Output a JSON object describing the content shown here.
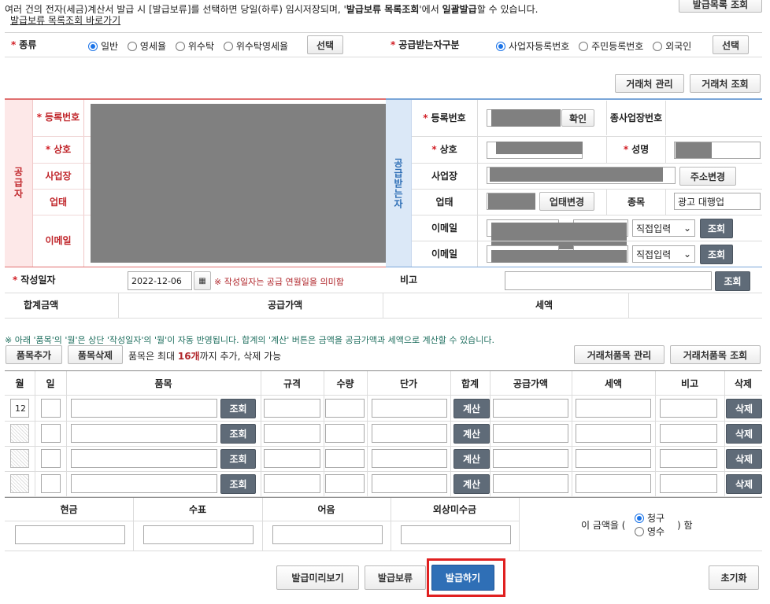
{
  "notice": {
    "line1_pre": "여러 건의 전자(세금)계산서 발급 시 [발급보류]를 선택하면 당일(하루) 임시저장되며, '",
    "line1_b1": "발급보류 목록조회",
    "line1_mid": "'에서 ",
    "line1_b2": "일괄발급",
    "line1_post": "할 수 있습니다.",
    "link": "발급보류 목록조회 바로가기",
    "top_button": "발급목록 조회"
  },
  "type_row": {
    "label": "종류",
    "options": [
      "일반",
      "영세율",
      "위수탁",
      "위수탁영세율"
    ],
    "selected": "일반",
    "select_button": "선택",
    "recipient_label": "공급받는자구분",
    "recipient_options": [
      "사업자등록번호",
      "주민등록번호",
      "외국인"
    ],
    "recipient_selected": "사업자등록번호",
    "recipient_button": "선택"
  },
  "partner_buttons": {
    "manage": "거래처 관리",
    "lookup": "거래처 조회"
  },
  "supplier": {
    "side_label": "공급자",
    "reg_no": "등록번호",
    "company": "상호",
    "address": "사업장",
    "business_type": "업태",
    "email": "이메일"
  },
  "receiver": {
    "side_label": "공급받는자",
    "reg_no": "등록번호",
    "confirm_button": "확인",
    "sub_business": "종사업장번호",
    "company": "상호",
    "name": "성명",
    "address": "사업장",
    "address_button": "주소변경",
    "business_type": "업태",
    "business_button": "업태변경",
    "item_label": "종목",
    "item_value": "광고 대행업",
    "email": "이메일",
    "email_select": "직접입력",
    "lookup_button": "조회"
  },
  "date_row": {
    "label": "작성일자",
    "value": "2022-12-06",
    "note": "※ 작성일자는 공급 연월일을 의미함",
    "memo_label": "비고",
    "lookup_button": "조회"
  },
  "totals": {
    "total": "합계금액",
    "supply": "공급가액",
    "tax": "세액"
  },
  "items_notice": "※ 아래 '품목'의 '월'은 상단 '작성일자'의 '월'이 자동 반영됩니다. 합계의 '계산' 버튼은 금액을 공급가액과 세액으로 계산할 수 있습니다.",
  "item_toolbar": {
    "add": "품목추가",
    "delete": "품목삭제",
    "limit_pre": "품목은 최대 ",
    "limit_num": "16개",
    "limit_post": "까지 추가, 삭제 가능",
    "manage": "거래처품목 관리",
    "lookup": "거래처품목 조회"
  },
  "item_table": {
    "headers": [
      "월",
      "일",
      "품목",
      "규격",
      "수량",
      "단가",
      "합계",
      "공급가액",
      "세액",
      "비고",
      "삭제"
    ],
    "first_month": "12",
    "lookup": "조회",
    "calc": "계산",
    "delete": "삭제"
  },
  "payment": {
    "headers": [
      "현금",
      "수표",
      "어음",
      "외상미수금"
    ],
    "amount_pre": "이 금액을 (",
    "amount_post": ") 함",
    "options": [
      "청구",
      "영수"
    ],
    "selected": "청구"
  },
  "actions": {
    "preview": "발급미리보기",
    "hold": "발급보류",
    "issue": "발급하기",
    "reset": "초기화"
  },
  "colors": {
    "primary": "#2f6fb6",
    "highlight": "#e02020",
    "accent_red": "#c0262b"
  }
}
